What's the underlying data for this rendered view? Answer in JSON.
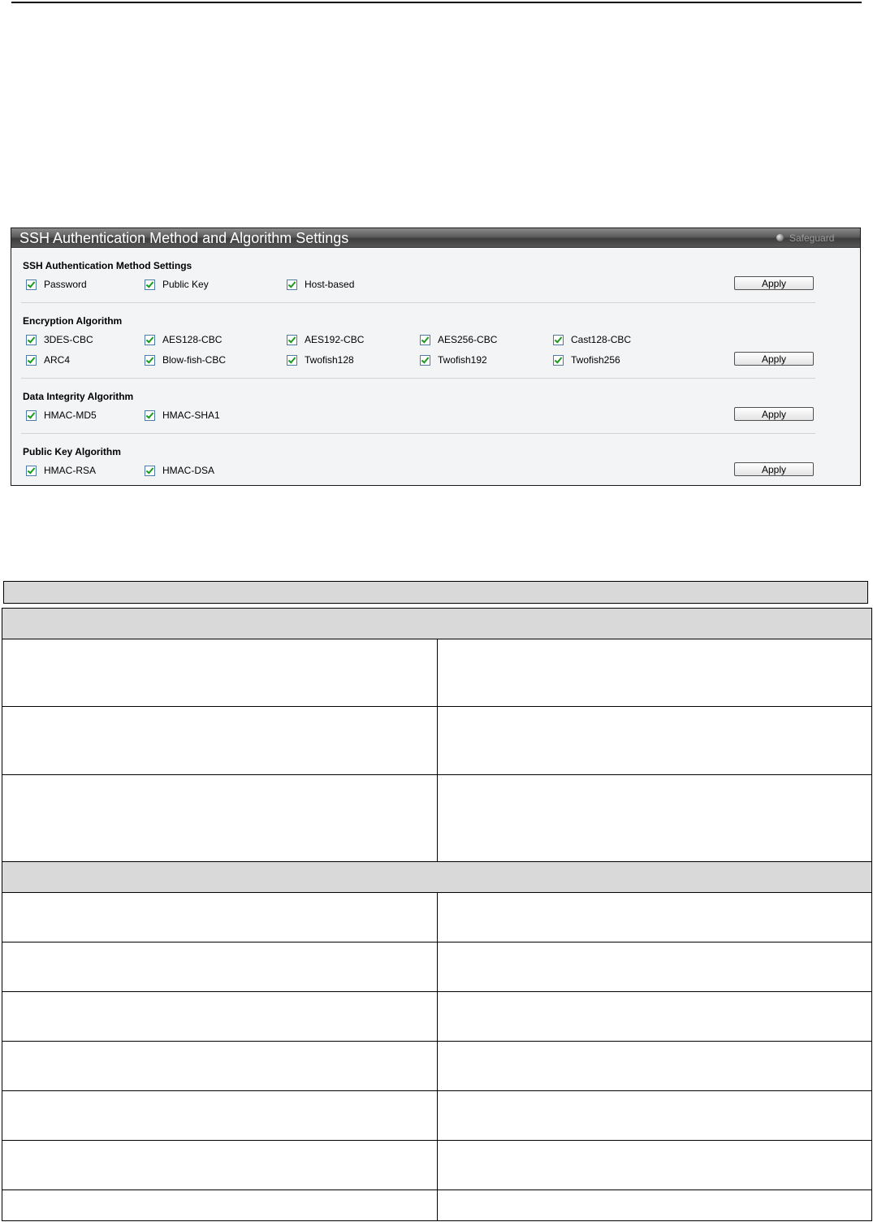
{
  "panel": {
    "title": "SSH Authentication Method and Algorithm Settings",
    "safeguard_label": "Safeguard",
    "apply_label": "Apply"
  },
  "sections": {
    "auth_method": {
      "title": "SSH Authentication Method Settings",
      "items": [
        {
          "label": "Password",
          "checked": true
        },
        {
          "label": "Public Key",
          "checked": true
        },
        {
          "label": "Host-based",
          "checked": true
        }
      ]
    },
    "encryption": {
      "title": "Encryption Algorithm",
      "row1": [
        {
          "label": "3DES-CBC",
          "checked": true
        },
        {
          "label": "AES128-CBC",
          "checked": true
        },
        {
          "label": "AES192-CBC",
          "checked": true
        },
        {
          "label": "AES256-CBC",
          "checked": true
        },
        {
          "label": "Cast128-CBC",
          "checked": true
        }
      ],
      "row2": [
        {
          "label": "ARC4",
          "checked": true
        },
        {
          "label": "Blow-fish-CBC",
          "checked": true
        },
        {
          "label": "Twofish128",
          "checked": true
        },
        {
          "label": "Twofish192",
          "checked": true
        },
        {
          "label": "Twofish256",
          "checked": true
        }
      ]
    },
    "data_integrity": {
      "title": "Data Integrity Algorithm",
      "items": [
        {
          "label": "HMAC-MD5",
          "checked": true
        },
        {
          "label": "HMAC-SHA1",
          "checked": true
        }
      ]
    },
    "public_key": {
      "title": "Public Key Algorithm",
      "items": [
        {
          "label": "HMAC-RSA",
          "checked": true
        },
        {
          "label": "HMAC-DSA",
          "checked": true
        }
      ]
    }
  },
  "colors": {
    "header_dark": "#3d3d3d",
    "panel_bg": "#f2f4f6",
    "check_green": "#1d9a1d",
    "table_shade": "#d9d9d9"
  }
}
